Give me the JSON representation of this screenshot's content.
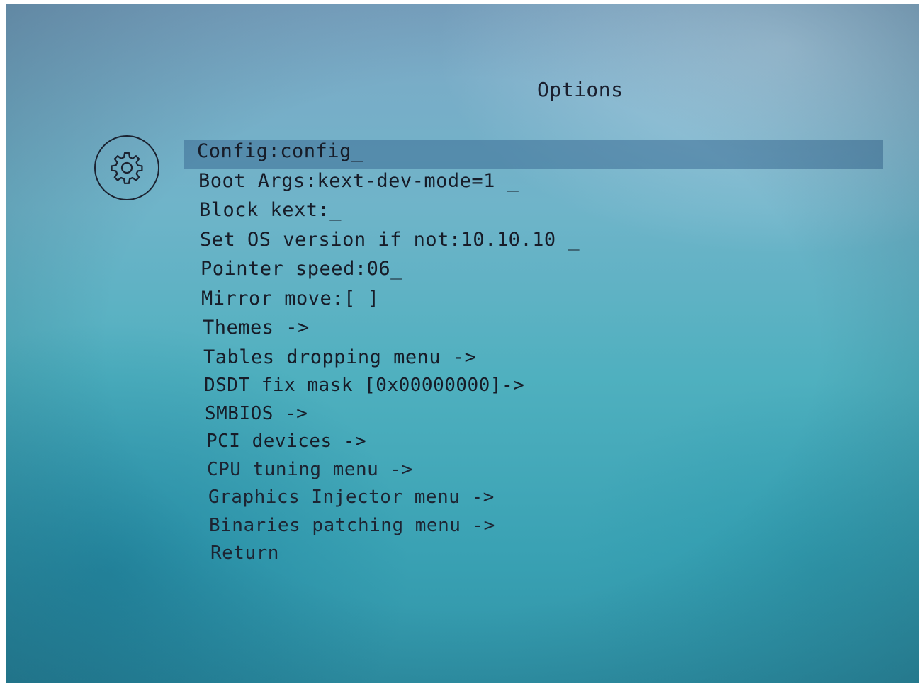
{
  "screen": {
    "title": "Options",
    "icon": "gear-icon"
  },
  "menu": {
    "selected_index": 0,
    "items": [
      {
        "label": "Config:config_"
      },
      {
        "label": "Boot Args:kext-dev-mode=1 _"
      },
      {
        "label": "Block kext:_"
      },
      {
        "label": "Set OS version if not:10.10.10 _"
      },
      {
        "label": "Pointer speed:06_"
      },
      {
        "label": "Mirror move:[ ]"
      },
      {
        "label": "Themes ->"
      },
      {
        "label": "Tables dropping menu ->"
      },
      {
        "label": "DSDT fix mask [0x00000000]->"
      },
      {
        "label": "SMBIOS ->"
      },
      {
        "label": "PCI devices ->"
      },
      {
        "label": "CPU tuning menu ->"
      },
      {
        "label": "Graphics Injector menu ->"
      },
      {
        "label": "Binaries patching menu ->"
      },
      {
        "label": "Return"
      }
    ]
  },
  "colors": {
    "background_top": "#7fa8c6",
    "background_bottom": "#2f93a7",
    "text": "#171c28",
    "selection": "#3c6e96"
  }
}
